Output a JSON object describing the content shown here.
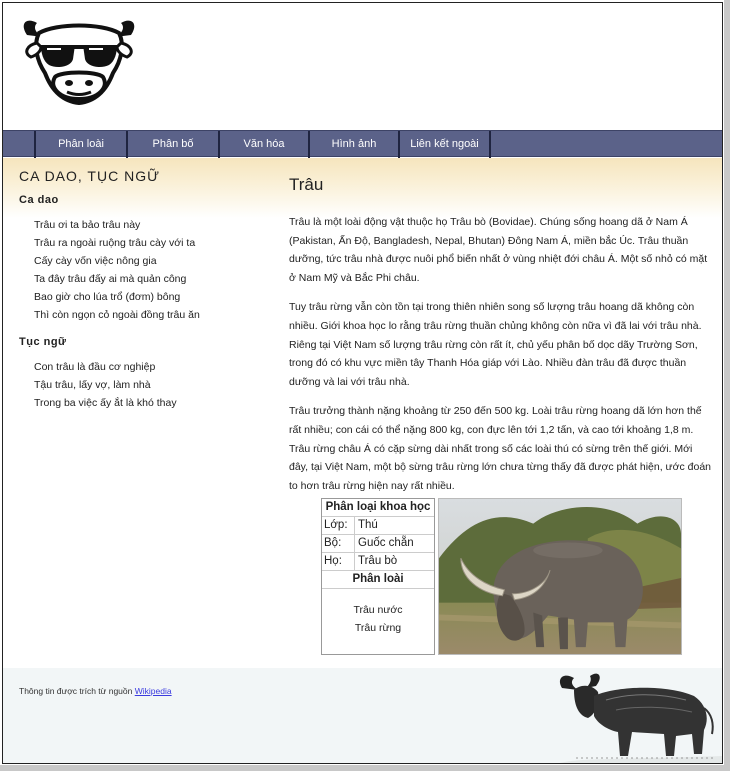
{
  "nav": {
    "items": [
      "Phân loài",
      "Phân bố",
      "Văn hóa",
      "Hình ảnh",
      "Liên kết ngoài"
    ]
  },
  "sidebar": {
    "title": "CA DAO, TỤC NGỮ",
    "sections": [
      {
        "heading": "Ca dao",
        "items": [
          "Trâu ơi ta bảo trâu này",
          "Trâu ra ngoài ruộng trâu cày với ta",
          "Cấy cày vốn việc nông gia",
          "Ta đây trâu đấy ai mà quản công",
          "Bao giờ cho lúa trổ (đơm) bông",
          "Thì còn ngọn cỏ ngoài đồng trâu ăn"
        ]
      },
      {
        "heading": "Tục ngữ",
        "items": [
          "Con trâu là đầu cơ nghiệp",
          "Tậu trâu, lấy vợ, làm nhà",
          "Trong ba việc ấy ắt là khó thay"
        ]
      }
    ]
  },
  "main": {
    "title": "Trâu",
    "paragraphs": [
      "Trâu là một loài động vật thuộc họ Trâu bò (Bovidae). Chúng sống hoang dã ở Nam Á (Pakistan, Ấn Độ, Bangladesh, Nepal, Bhutan) Đông Nam Á, miền bắc Úc. Trâu thuần dưỡng, tức trâu nhà được nuôi phổ biến nhất ở vùng nhiệt đới châu Á. Một số nhỏ có mặt ở Nam Mỹ và Bắc Phi châu.",
      "Tuy trâu rừng vẫn còn tồn tại trong thiên nhiên song số lượng trâu hoang dã không còn nhiều. Giới khoa học lo rằng trâu rừng thuần chủng không còn nữa vì đã lai với trâu nhà. Riêng tại Việt Nam số lượng trâu rừng còn rất ít, chủ yếu phân bố dọc dãy Trường Sơn, trong đó có khu vực miền tây Thanh Hóa giáp với Lào. Nhiều đàn trâu đã được thuần dưỡng và lai với trâu nhà.",
      "Trâu trưởng thành nặng khoảng từ 250 đến 500 kg. Loài trâu rừng hoang dã lớn hơn thế rất nhiều; con cái có thể nặng 800 kg, con đực lên tới 1,2 tấn, và cao tới khoảng 1,8 m. Trâu rừng châu Á có cặp sừng dài nhất trong số các loài thú có sừng trên thế giới. Mới đây, tại Việt Nam, một bộ sừng trâu rừng lớn chưa từng thấy đã được phát hiện, ước đoán to hơn trâu rừng hiện nay rất nhiều."
    ]
  },
  "taxonomy": {
    "title": "Phân loại khoa học",
    "rows": [
      {
        "key": "Lớp:",
        "value": "Thú"
      },
      {
        "key": "Bộ:",
        "value": "Guốc chẵn"
      },
      {
        "key": "Họ:",
        "value": "Trâu bò"
      }
    ],
    "subheading": "Phân loài",
    "species": [
      "Trâu nước",
      "Trâu rừng"
    ]
  },
  "footer": {
    "credit_text": "Thông tin được trích từ nguồn",
    "credit_link": "Wikipedia"
  },
  "colors": {
    "nav_bg": "#5b6289",
    "band_top": "#f6e5bd",
    "footer_bg": "#f2f6f7",
    "link": "#3a3adf"
  },
  "icons": {
    "logo": "cool-buffalo-sunglasses-icon",
    "footer_art": "buffalo-sketch-icon"
  }
}
